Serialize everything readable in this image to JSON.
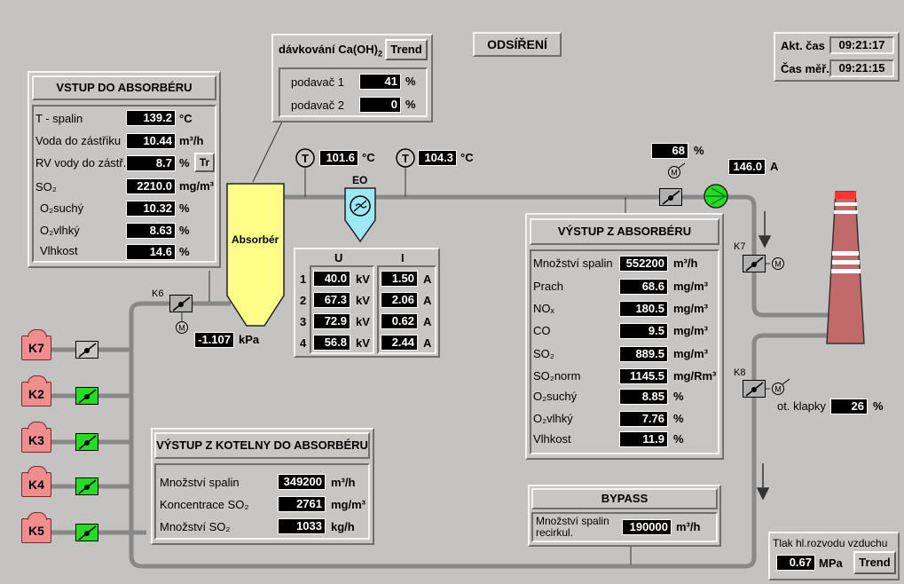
{
  "title": "ODSÍŘENÍ",
  "time": {
    "akt_label": "Akt. čas",
    "akt_value": "09:21:17",
    "mer_label": "Čas měř.",
    "mer_value": "09:21:15"
  },
  "dosing": {
    "title_pre": "dávkování Ca(OH)",
    "title_sub": "2",
    "trend_label": "Trend",
    "rows": [
      {
        "label": "podavač 1",
        "value": "41",
        "unit": "%"
      },
      {
        "label": "podavač 2",
        "value": "0",
        "unit": "%"
      }
    ]
  },
  "inlet": {
    "title": "VSTUP DO ABSORBÉRU",
    "t_label": "T - spalin",
    "t_value": "139.2",
    "t_unit": "°C",
    "water_label": "Voda do zástřiku",
    "water_value": "10.44",
    "water_unit": "m³/h",
    "rv_label": "RV vody do zástř.",
    "rv_value": "8.7",
    "rv_unit": "%",
    "tr_label": "Tr",
    "so2_label": "SO₂",
    "so2_value": "2210.0",
    "so2_unit": "mg/m³",
    "o2d_label": "O₂suchý",
    "o2d_value": "10.32",
    "o2d_unit": "%",
    "o2w_label": "O₂vlhký",
    "o2w_value": "8.63",
    "o2w_unit": "%",
    "hum_label": "Vlhkost",
    "hum_value": "14.6",
    "hum_unit": "%"
  },
  "absorber_label": "Absorbér",
  "eo_label": "EO",
  "temp1": {
    "value": "101.6",
    "unit": "°C"
  },
  "temp2": {
    "value": "104.3",
    "unit": "°C"
  },
  "fan": {
    "percent": "68",
    "percent_unit": "%",
    "current": "146.0",
    "current_unit": "A"
  },
  "pressure": {
    "value": "-1.107",
    "unit": "kPa"
  },
  "eo_table": {
    "u_header": "U",
    "i_header": "I",
    "rows": [
      {
        "n": "1",
        "u": "40.0",
        "u_unit": "kV",
        "i": "1.50",
        "i_unit": "A"
      },
      {
        "n": "2",
        "u": "67.3",
        "u_unit": "kV",
        "i": "2.06",
        "i_unit": "A"
      },
      {
        "n": "3",
        "u": "72.9",
        "u_unit": "kV",
        "i": "0.62",
        "i_unit": "A"
      },
      {
        "n": "4",
        "u": "56.8",
        "u_unit": "kV",
        "i": "2.44",
        "i_unit": "A"
      }
    ]
  },
  "outlet": {
    "title": "VÝSTUP Z ABSORBÉRU",
    "rows": [
      {
        "label": "Množství spalin",
        "value": "552200",
        "unit": "m³/h"
      },
      {
        "label": "Prach",
        "value": "68.6",
        "unit": "mg/m³"
      },
      {
        "label": "NOₓ",
        "value": "180.5",
        "unit": "mg/m³"
      },
      {
        "label": "CO",
        "value": "9.5",
        "unit": "mg/m³"
      },
      {
        "label": "SO₂",
        "value": "889.5",
        "unit": "mg/m³"
      },
      {
        "label": "SO₂norm",
        "value": "1145.5",
        "unit": "mg/Rm³"
      },
      {
        "label": "O₂suchý",
        "value": "8.85",
        "unit": "%"
      },
      {
        "label": "O₂vlhký",
        "value": "7.76",
        "unit": "%"
      },
      {
        "label": "Vlhkost",
        "value": "11.9",
        "unit": "%"
      }
    ]
  },
  "boiler_out": {
    "title": "VÝSTUP Z KOTELNY DO ABSORBÉRU",
    "rows": [
      {
        "label": "Množství spalin",
        "value": "349200",
        "unit": "m³/h"
      },
      {
        "label": "Koncentrace SO₂",
        "value": "2761",
        "unit": "mg/m³"
      },
      {
        "label": "Množství SO₂",
        "value": "1033",
        "unit": "kg/h"
      }
    ]
  },
  "bypass": {
    "title": "BYPASS",
    "label1": "Množství spalin",
    "label2": "recirkul.",
    "value": "190000",
    "unit": "m³/h"
  },
  "air": {
    "label": "Tlak hl.rozvodu vzduchu",
    "value": "0.67",
    "unit": "MPa",
    "trend_label": "Trend"
  },
  "flap": {
    "label": "ot. klapky",
    "value": "26",
    "unit": "%"
  },
  "valves": {
    "k6": "K6",
    "k7": "K7",
    "k8": "K8"
  },
  "boilers": [
    "K7",
    "K2",
    "K3",
    "K4",
    "K5"
  ],
  "colors": {
    "background": "#c5c2c2",
    "pipe": "#8a8a8a",
    "absorber": "#ffff88",
    "eo": "#9ce8f4",
    "boiler": "#f08d8d",
    "valve_open": "#22dd22",
    "stack": "#c26a6a"
  }
}
